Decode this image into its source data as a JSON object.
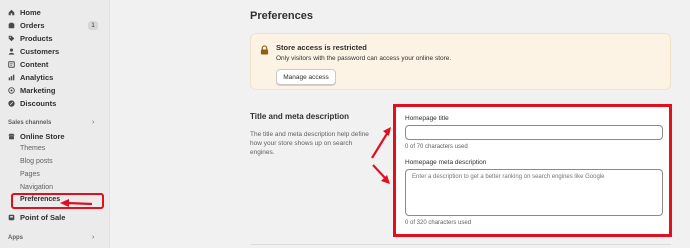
{
  "sidebar": {
    "items": [
      {
        "label": "Home",
        "icon": "home-icon"
      },
      {
        "label": "Orders",
        "icon": "orders-icon",
        "badge": "1"
      },
      {
        "label": "Products",
        "icon": "tag-icon"
      },
      {
        "label": "Customers",
        "icon": "person-icon"
      },
      {
        "label": "Content",
        "icon": "content-icon"
      },
      {
        "label": "Analytics",
        "icon": "chart-icon"
      },
      {
        "label": "Marketing",
        "icon": "target-icon"
      },
      {
        "label": "Discounts",
        "icon": "discount-icon"
      }
    ],
    "sales_channels_label": "Sales channels",
    "online_store": {
      "label": "Online Store",
      "icon": "store-icon"
    },
    "sub_items": [
      "Themes",
      "Blog posts",
      "Pages",
      "Navigation",
      "Preferences"
    ],
    "point_of_sale": {
      "label": "Point of Sale",
      "icon": "pos-icon"
    },
    "apps_label": "Apps"
  },
  "page": {
    "title": "Preferences"
  },
  "banner": {
    "title": "Store access is restricted",
    "description": "Only visitors with the password can access your online store.",
    "button_label": "Manage access"
  },
  "meta_section": {
    "title": "Title and meta description",
    "description": "The title and meta description help define how your store shows up on search engines."
  },
  "form": {
    "homepage_title_label": "Homepage title",
    "homepage_title_value": "",
    "homepage_title_help": "0 of 70 characters used",
    "meta_description_label": "Homepage meta description",
    "meta_description_placeholder": "Enter a description to get a better ranking on search engines like Google",
    "meta_description_help": "0 of 320 characters used"
  },
  "colors": {
    "annotation": "#e0101e",
    "banner_bg": "#fdf3e4",
    "active_green": "#303030"
  }
}
